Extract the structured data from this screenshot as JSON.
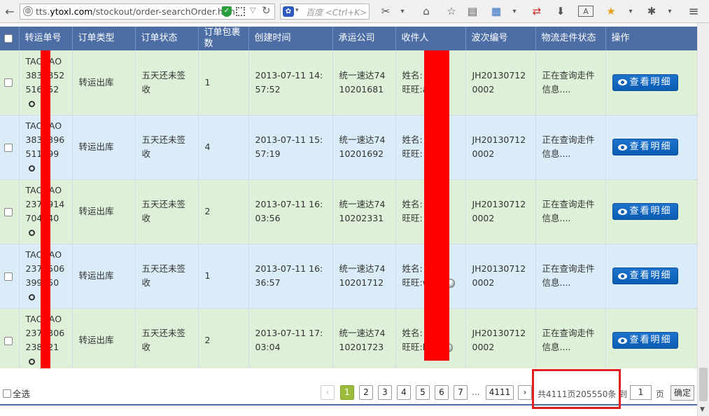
{
  "browser": {
    "url_prefix": "tts.",
    "url_domain": "ytoxl.com",
    "url_path": "/stockout/order-searchOrder.htm",
    "search_placeholder": "百度 <Ctrl+K>"
  },
  "table": {
    "columns": [
      "转运单号",
      "订单类型",
      "订单状态",
      "订单包裹数",
      "创建时间",
      "承运公司",
      "收件人",
      "波次编号",
      "物流走件状态",
      "操作"
    ],
    "rows": [
      {
        "no": "TAOBAO3833852516852",
        "type": "转运出库",
        "status": "五天还未签收",
        "pkg": "1",
        "created": "2013-07-11 14:57:52",
        "carrier": "统一速达7410201681",
        "name": "姓名:",
        "wangwang": "旺旺:a",
        "ww_online": true,
        "wave": "JH201307120002",
        "logistics": "正在查询走件信息....",
        "action": "查看明细"
      },
      {
        "no": "TAOBAO3833396511699",
        "type": "转运出库",
        "status": "五天还未签收",
        "pkg": "4",
        "created": "2013-07-11 15:57:19",
        "carrier": "统一速达7410201692",
        "name": "姓名:",
        "wangwang": "旺旺:",
        "ww_online": false,
        "wave": "JH201307120002",
        "logistics": "正在查询走件信息....",
        "action": "查看明细"
      },
      {
        "no": "TAOBAO2370914704940",
        "type": "转运出库",
        "status": "五天还未签收",
        "pkg": "2",
        "created": "2013-07-11 16:03:56",
        "carrier": "统一速达7410202331",
        "name": "姓名:",
        "wangwang": "旺旺:",
        "ww_online": false,
        "wave": "JH201307120002",
        "logistics": "正在查询走件信息....",
        "action": "查看明细"
      },
      {
        "no": "TAOBAO2370506399350",
        "type": "转运出库",
        "status": "五天还未签收",
        "pkg": "1",
        "created": "2013-07-11 16:36:57",
        "carrier": "统一速达7410201712",
        "name": "姓名:",
        "wangwang": "旺旺:w t b",
        "ww_online": false,
        "wave": "JH201307120002",
        "logistics": "正在查询走件信息....",
        "action": "查看明细"
      },
      {
        "no": "TAOBAO2373306238321",
        "type": "转运出库",
        "status": "五天还未签收",
        "pkg": "2",
        "created": "2013-07-11 17:03:04",
        "carrier": "统一速达7410201723",
        "name": "姓名:",
        "wangwang": "旺旺:h 30",
        "ww_online": false,
        "wave": "JH201307120002",
        "logistics": "正在查询走件信息....",
        "action": "查看明细"
      }
    ]
  },
  "footer": {
    "select_all": "全选",
    "pages": [
      "1",
      "2",
      "3",
      "4",
      "5",
      "6",
      "7"
    ],
    "active_page": "1",
    "ellipsis": "...",
    "last_page": "4111",
    "prev": "‹",
    "next": "›",
    "total": "共4111页205550条 到",
    "goto_value": "1",
    "page_unit": "页",
    "confirm": "确定"
  },
  "colors": {
    "header": "#4d6ea5",
    "row_green": "#dff0d8",
    "row_blue": "#d9ecf7",
    "button": "#0b5cb3",
    "active_page": "#9bbc3a",
    "redaction": "#ff0000",
    "highlight_box": "#e0201f"
  }
}
